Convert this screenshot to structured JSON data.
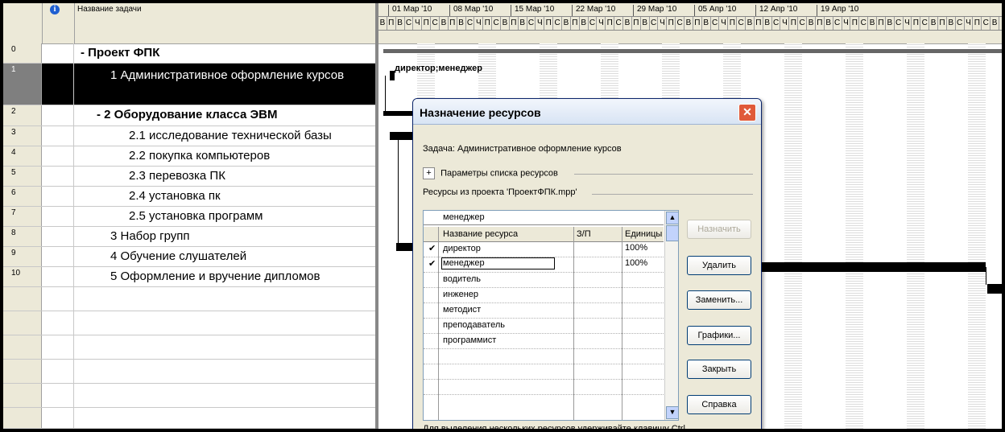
{
  "table": {
    "header_name": "Название задачи",
    "rows": [
      {
        "num": "0",
        "name": "- Проект ФПК"
      },
      {
        "num": "1",
        "name": "1 Административное оформление курсов"
      },
      {
        "num": "2",
        "name": "- 2 Оборудование класса ЭВМ"
      },
      {
        "num": "3",
        "name": "2.1 исследование технической базы"
      },
      {
        "num": "4",
        "name": "2.2 покупка компьютеров"
      },
      {
        "num": "5",
        "name": "2.3 перевозка ПК"
      },
      {
        "num": "6",
        "name": "2.4 установка пк"
      },
      {
        "num": "7",
        "name": "2.5 установка программ"
      },
      {
        "num": "8",
        "name": "3 Набор групп"
      },
      {
        "num": "9",
        "name": "4 Обучение слушателей"
      },
      {
        "num": "10",
        "name": "5 Оформление и вручение дипломов"
      }
    ]
  },
  "timeline": {
    "weeks": [
      "01 Мар '10",
      "08 Мар '10",
      "15 Мар '10",
      "22 Мар '10",
      "29 Мар '10",
      "05 Апр '10",
      "12 Апр '10",
      "19 Апр '10"
    ],
    "day_letters": [
      "В",
      "П",
      "В",
      "С",
      "Ч",
      "П",
      "С"
    ],
    "resource_label": "директор;менеджер"
  },
  "dialog": {
    "title": "Назначение ресурсов",
    "task_line": "Задача: Административное оформление курсов",
    "expand_label": "Параметры списка ресурсов",
    "resources_from": "Ресурсы из проекта 'ПроектФПК.mpp'",
    "filter_value": "менеджер",
    "columns": {
      "name": "Название ресурса",
      "rp": "З/П",
      "units": "Единицы"
    },
    "resources": [
      {
        "checked": "✔",
        "name": "директор",
        "units": "100%"
      },
      {
        "checked": "✔",
        "name": "менеджер",
        "units": "100%"
      },
      {
        "checked": "",
        "name": "водитель",
        "units": ""
      },
      {
        "checked": "",
        "name": "инженер",
        "units": ""
      },
      {
        "checked": "",
        "name": "методист",
        "units": ""
      },
      {
        "checked": "",
        "name": "преподаватель",
        "units": ""
      },
      {
        "checked": "",
        "name": "программист",
        "units": ""
      },
      {
        "checked": "",
        "name": "",
        "units": ""
      },
      {
        "checked": "",
        "name": "",
        "units": ""
      },
      {
        "checked": "",
        "name": "",
        "units": ""
      }
    ],
    "buttons": {
      "assign": "Назначить",
      "remove": "Удалить",
      "replace": "Заменить...",
      "graphs": "Графики...",
      "close": "Закрыть",
      "help": "Справка"
    },
    "hint": "Для выделения нескольких ресурсов удерживайте клавишу Ctrl"
  }
}
